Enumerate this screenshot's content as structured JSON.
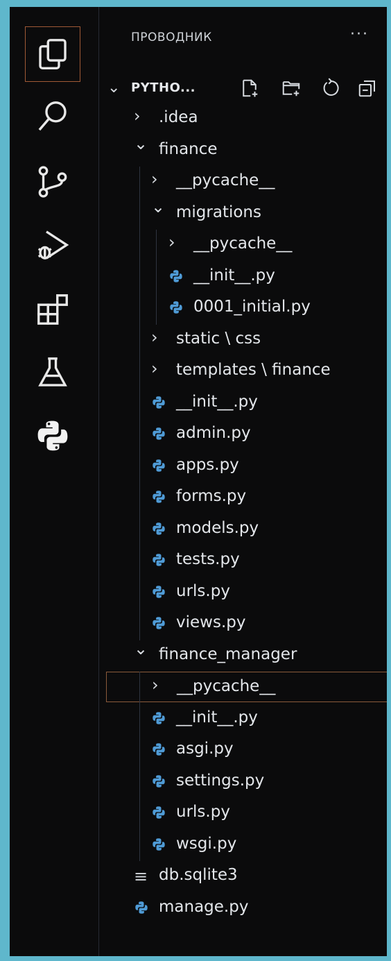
{
  "activity_bar": [
    {
      "name": "explorer-icon",
      "active": true
    },
    {
      "name": "search-icon",
      "active": false
    },
    {
      "name": "source-control-icon",
      "active": false
    },
    {
      "name": "run-debug-icon",
      "active": false
    },
    {
      "name": "extensions-icon",
      "active": false
    },
    {
      "name": "testing-icon",
      "active": false
    },
    {
      "name": "python-icon",
      "active": false
    }
  ],
  "explorer": {
    "title": "ПРОВОДНИК",
    "more": "···",
    "root_label": "PYTHO...",
    "toolbar_icons": [
      "new-file-icon",
      "new-folder-icon",
      "refresh-icon",
      "collapse-all-icon"
    ]
  },
  "tree": [
    {
      "label": ".idea",
      "kind": "folder",
      "expanded": false
    },
    {
      "label": "finance",
      "kind": "folder",
      "expanded": true
    },
    {
      "label": "__pycache__",
      "kind": "folder",
      "expanded": false
    },
    {
      "label": "migrations",
      "kind": "folder",
      "expanded": true
    },
    {
      "label": "__pycache__",
      "kind": "folder",
      "expanded": false
    },
    {
      "label": "__init__.py",
      "kind": "py"
    },
    {
      "label": "0001_initial.py",
      "kind": "py"
    },
    {
      "label": "static \\ css",
      "kind": "folder",
      "expanded": false
    },
    {
      "label": "templates \\ finance",
      "kind": "folder",
      "expanded": false
    },
    {
      "label": "__init__.py",
      "kind": "py"
    },
    {
      "label": "admin.py",
      "kind": "py"
    },
    {
      "label": "apps.py",
      "kind": "py"
    },
    {
      "label": "forms.py",
      "kind": "py"
    },
    {
      "label": "models.py",
      "kind": "py"
    },
    {
      "label": "tests.py",
      "kind": "py"
    },
    {
      "label": "urls.py",
      "kind": "py"
    },
    {
      "label": "views.py",
      "kind": "py"
    },
    {
      "label": "finance_manager",
      "kind": "folder",
      "expanded": true
    },
    {
      "label": "__pycache__",
      "kind": "folder",
      "expanded": false,
      "selected": true
    },
    {
      "label": "__init__.py",
      "kind": "py"
    },
    {
      "label": "asgi.py",
      "kind": "py"
    },
    {
      "label": "settings.py",
      "kind": "py"
    },
    {
      "label": "urls.py",
      "kind": "py"
    },
    {
      "label": "wsgi.py",
      "kind": "py"
    },
    {
      "label": "db.sqlite3",
      "kind": "db"
    },
    {
      "label": "manage.py",
      "kind": "py"
    }
  ],
  "colors": {
    "background": "#0b0b0c",
    "frame": "#5fb7cc",
    "selection_border": "#8a5a3a",
    "python_blue": "#4f9bd6",
    "python_yellow": "#e8c84a"
  }
}
